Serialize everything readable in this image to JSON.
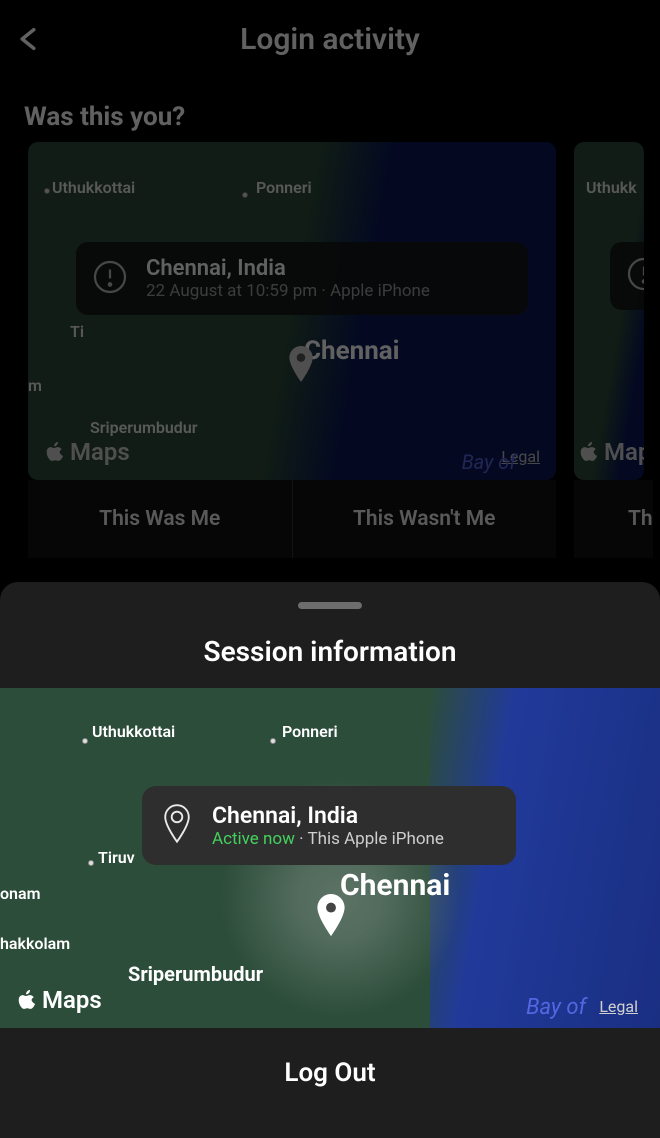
{
  "header": {
    "title": "Login activity"
  },
  "section_heading": "Was this you?",
  "cards": [
    {
      "location": "Chennai, India",
      "subtitle": "22 August at 10:59 pm · Apple iPhone",
      "map": {
        "big_city": "Chennai",
        "towns": {
          "uthukkottai": "Uthukkottai",
          "ponneri": "Ponneri",
          "sriperumbudur": "Sriperumbudur",
          "tiru_partial": "Ti",
          "m_partial": "m"
        },
        "apple_maps": "Maps",
        "legal": "Legal",
        "bay": "Bay of"
      },
      "buttons": {
        "was_me": "This Was Me",
        "wasnt_me": "This Wasn't Me"
      }
    },
    {
      "map": {
        "towns": {
          "uthukkottai_partial": "Uthukk"
        },
        "apple_maps_partial": "Map"
      },
      "button_partial": "Th"
    }
  ],
  "sheet": {
    "title": "Session information",
    "badge": {
      "location": "Chennai, India",
      "active": "Active now",
      "separator": " · ",
      "device": "This Apple iPhone"
    },
    "map": {
      "big_city": "Chennai",
      "towns": {
        "uthukkottai": "Uthukkottai",
        "ponneri": "Ponneri",
        "sriperumbudur": "Sriperumbudur",
        "tiruv": "Tiruv",
        "hakkolam": "hakkolam",
        "onam": "onam"
      },
      "apple_maps": "Maps",
      "legal": "Legal",
      "bay": "Bay of"
    },
    "logout": "Log Out"
  }
}
